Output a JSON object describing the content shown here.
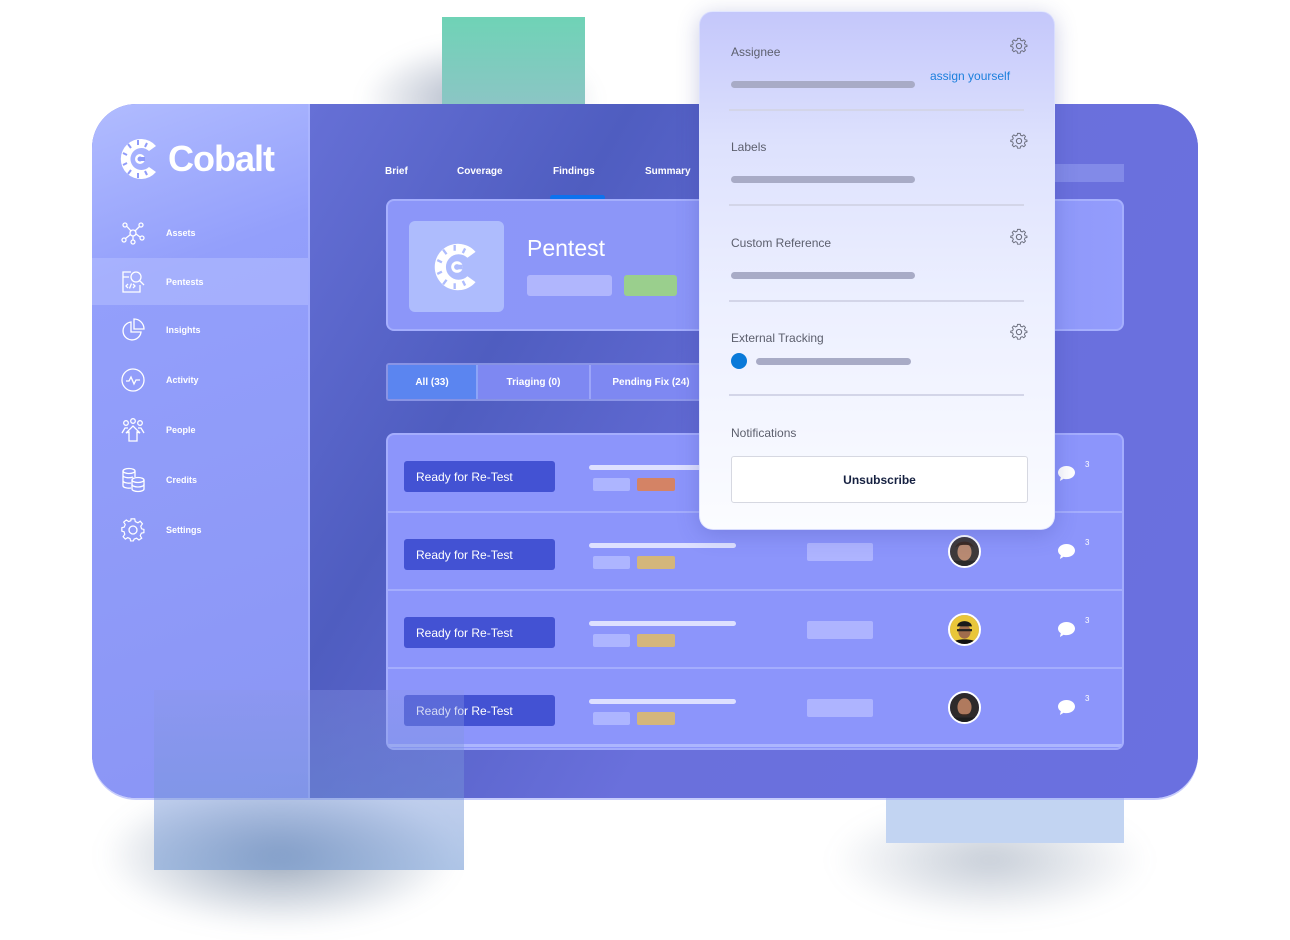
{
  "brand": {
    "name": "Cobalt"
  },
  "sidebar": {
    "items": [
      {
        "label": "Assets",
        "icon": "network-nodes-icon",
        "active": false
      },
      {
        "label": "Pentests",
        "icon": "code-search-icon",
        "active": true
      },
      {
        "label": "Insights",
        "icon": "pie-chart-icon",
        "active": false
      },
      {
        "label": "Activity",
        "icon": "activity-pulse-icon",
        "active": false
      },
      {
        "label": "People",
        "icon": "people-group-icon",
        "active": false
      },
      {
        "label": "Credits",
        "icon": "coin-stack-icon",
        "active": false
      },
      {
        "label": "Settings",
        "icon": "gear-icon",
        "active": false
      }
    ]
  },
  "tabs": [
    {
      "label": "Brief",
      "active": false
    },
    {
      "label": "Coverage",
      "active": false
    },
    {
      "label": "Findings",
      "active": true
    },
    {
      "label": "Summary",
      "active": false
    }
  ],
  "pentest": {
    "title": "Pentest"
  },
  "filters": [
    {
      "label": "All (33)",
      "active": true
    },
    {
      "label": "Triaging (0)",
      "active": false
    },
    {
      "label": "Pending Fix (24)",
      "active": false
    }
  ],
  "findings": [
    {
      "status": "Ready for Re-Test",
      "severity_color": "#d48365",
      "comments": "3",
      "avatar": "none"
    },
    {
      "status": "Ready for Re-Test",
      "severity_color": "#d4b67b",
      "comments": "3",
      "avatar": "user-avatar-1"
    },
    {
      "status": "Ready for Re-Test",
      "severity_color": "#d4b67b",
      "comments": "3",
      "avatar": "user-avatar-2"
    },
    {
      "status": "Ready for Re-Test",
      "severity_color": "#d4b67b",
      "comments": "3",
      "avatar": "user-avatar-3"
    }
  ],
  "popover": {
    "assignee": {
      "label": "Assignee",
      "link": "assign yourself"
    },
    "labels": {
      "label": "Labels"
    },
    "custom_reference": {
      "label": "Custom Reference"
    },
    "external_tracking": {
      "label": "External Tracking"
    },
    "notifications": {
      "label": "Notifications",
      "button": "Unsubscribe"
    }
  },
  "colors": {
    "accent": "#0d72ee",
    "status_button": "#4352d3",
    "link": "#1b7fdc",
    "pentest_status": "#9acf8d"
  }
}
